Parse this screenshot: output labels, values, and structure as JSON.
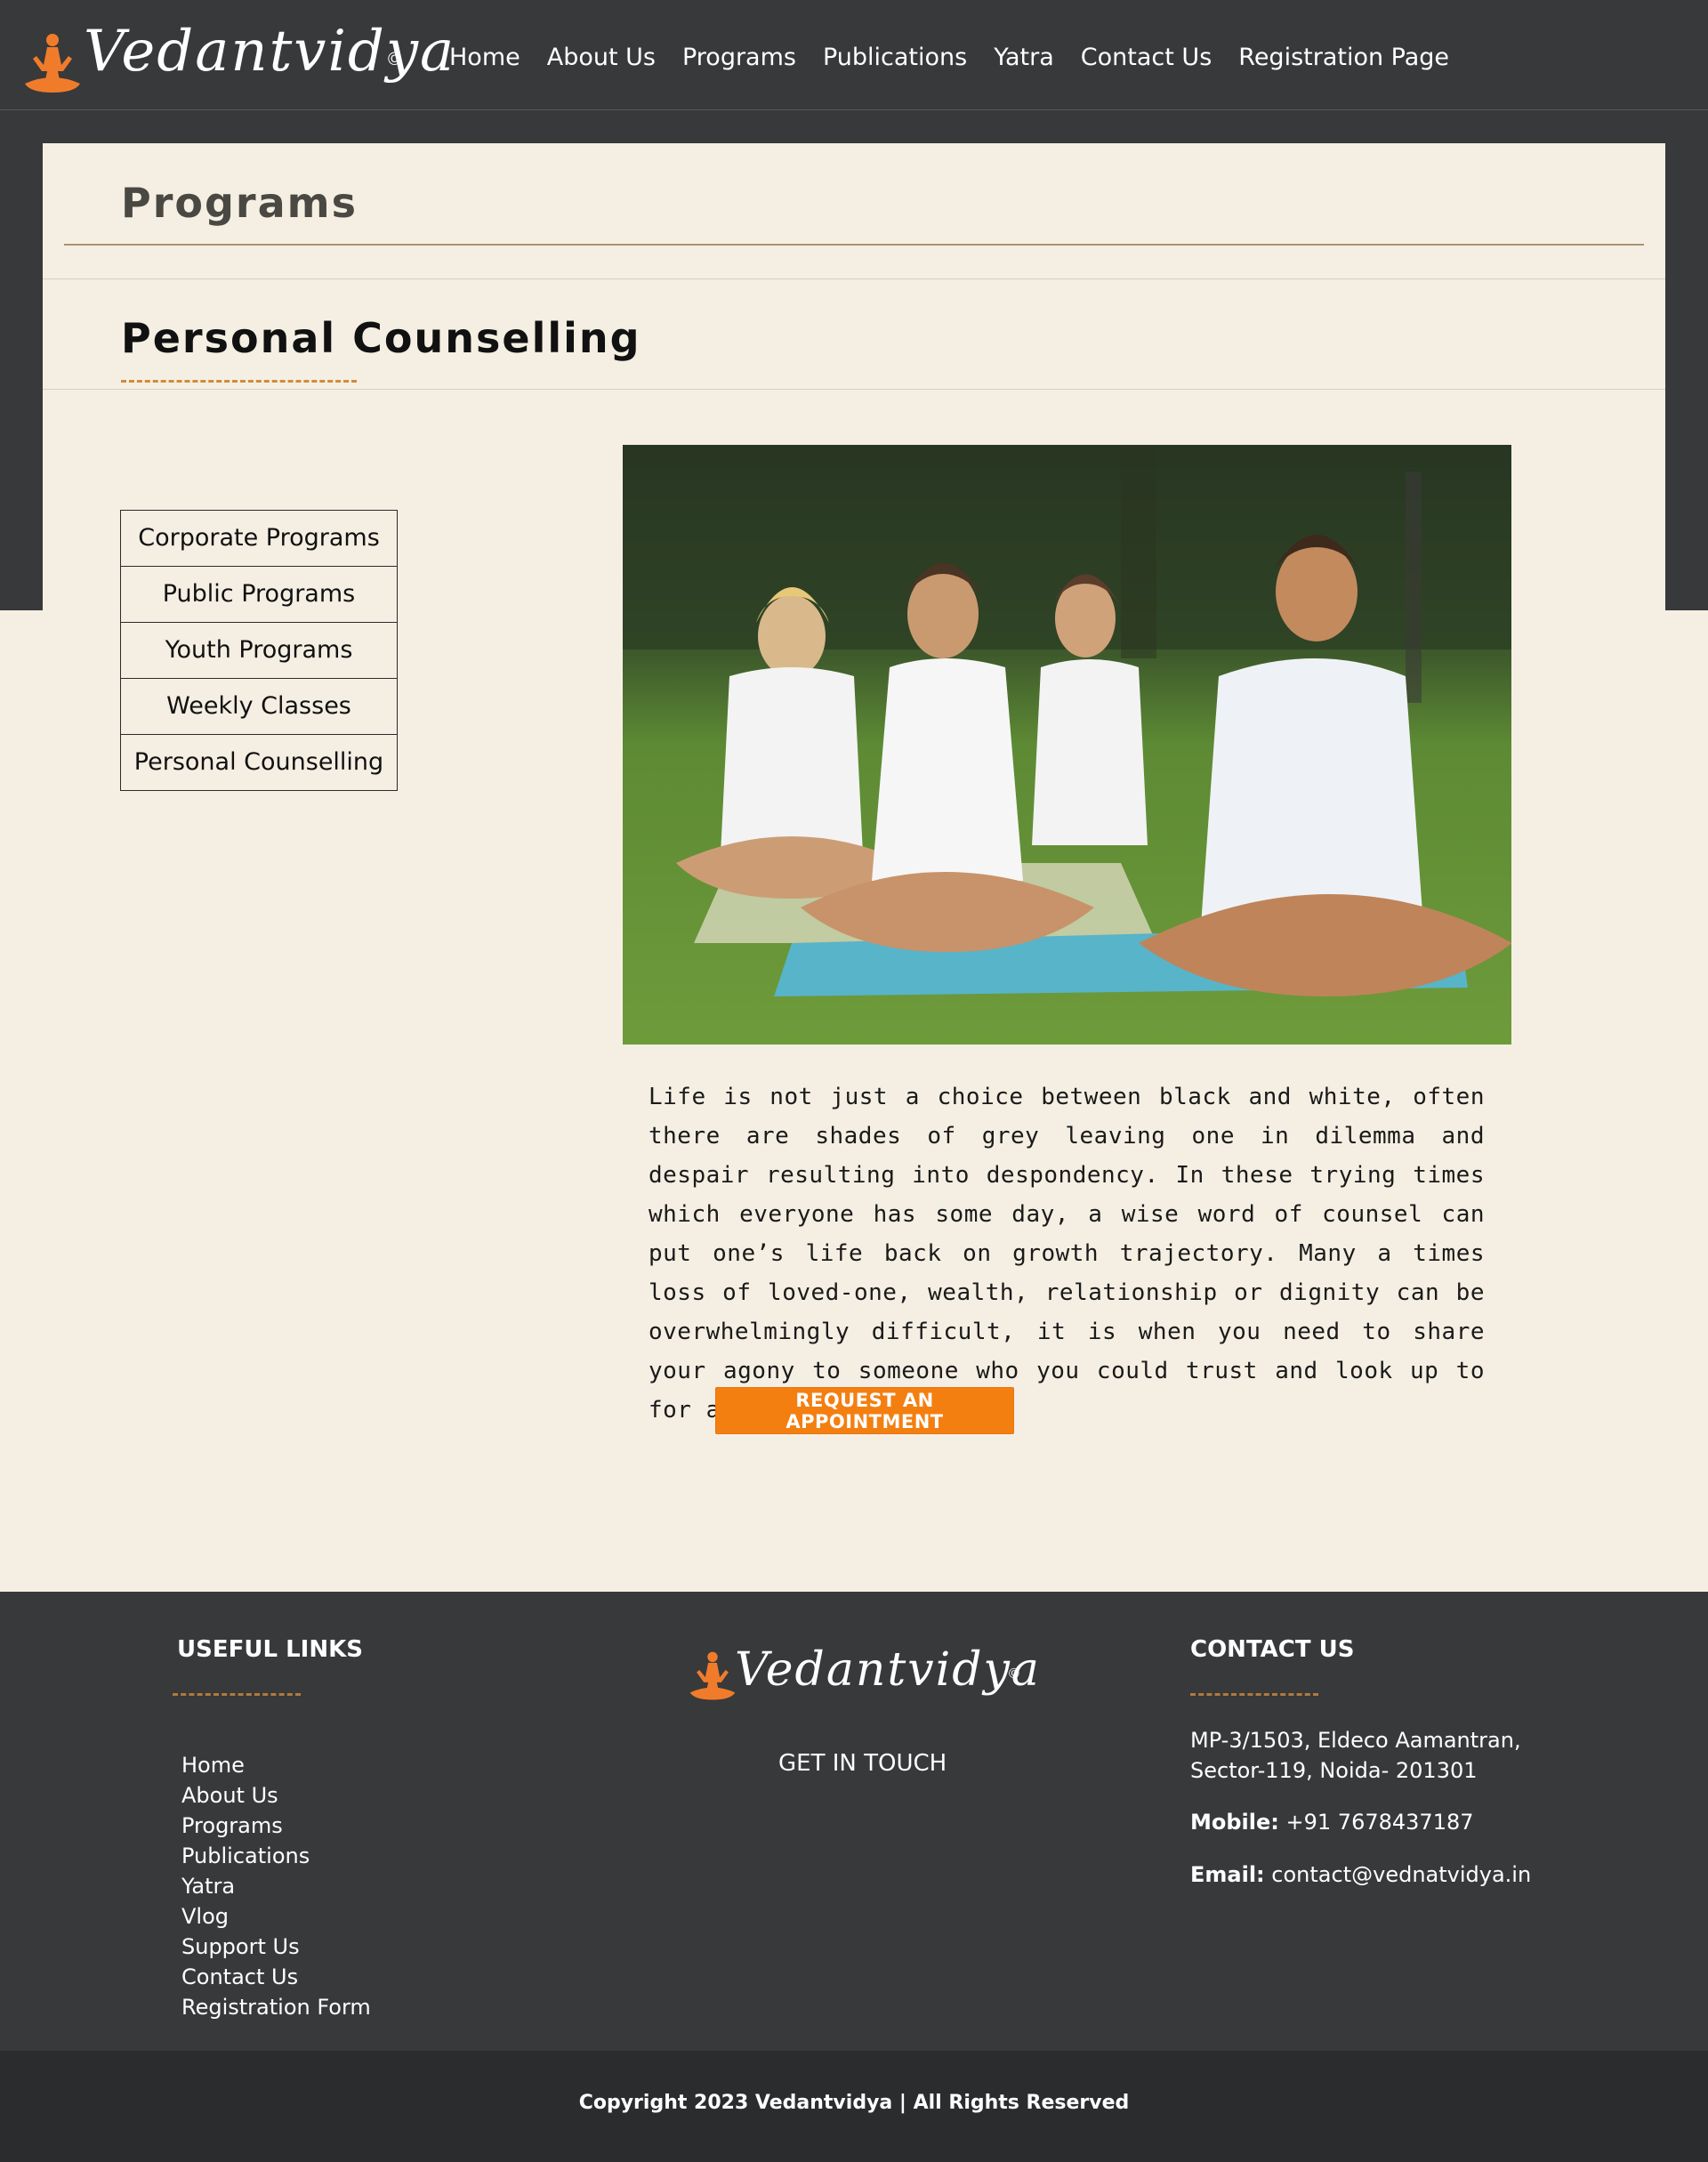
{
  "header": {
    "brand": "Vedantvidya",
    "brand_mark": "©",
    "nav": [
      "Home",
      "About Us",
      "Programs",
      "Publications",
      "Yatra",
      "Contact Us",
      "Registration Page"
    ]
  },
  "page": {
    "title": "Programs",
    "section_title": "Personal Counselling"
  },
  "side_menu": [
    "Corporate Programs",
    "Public Programs",
    "Youth Programs",
    "Weekly Classes",
    "Personal Counselling"
  ],
  "content": {
    "description": "Life is not just a choice between black and white, often there are shades of grey leaving one in dilemma and despair resulting into despondency. In these trying times which everyone has some day, a wise word of counsel can put one’s life back on growth trajectory. Many a times loss of loved-one, wealth, relationship or dignity can be overwhelmingly difficult, it is when you need to share your agony to someone who you could trust and look up to for an advice.",
    "cta_label": "REQUEST AN APPOINTMENT"
  },
  "footer": {
    "useful_links_heading": "USEFUL LINKS",
    "useful_links": [
      "Home",
      "About Us",
      "Programs",
      "Publications",
      "Yatra",
      "Vlog",
      "Support Us",
      "Contact Us",
      "Registration Form"
    ],
    "brand": "Vedantvidya",
    "brand_mark": "©",
    "get_in_touch": "GET IN TOUCH",
    "contact_heading": "CONTACT US",
    "address_line1": "MP-3/1503, Eldeco Aamantran,",
    "address_line2": "Sector-119, Noida- 201301",
    "mobile_label": "Mobile:",
    "mobile": "+91 7678437187",
    "email_label": "Email:",
    "email": "contact@vednatvidya.in",
    "copyright": "Copyright 2023 Vedantvidya | All Rights Reserved"
  },
  "colors": {
    "dark_band": "#38393b",
    "cream": "#f5efe3",
    "accent_orange": "#f47f11",
    "rule_tan": "#a99271"
  }
}
